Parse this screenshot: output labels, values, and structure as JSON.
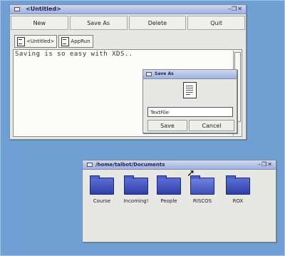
{
  "main_window": {
    "title": "<Untitled>",
    "controls": "–❐✕",
    "toolbar": {
      "new": "New",
      "save_as": "Save As",
      "delete": "Delete",
      "quit": "Quit"
    },
    "tabs": [
      {
        "label": "<Untitled>"
      },
      {
        "label": "AppRun"
      }
    ],
    "text": "Saving is so easy with XDS.."
  },
  "save_dialog": {
    "title": "Save As",
    "filename": "TextFile",
    "save_label": "Save",
    "cancel_label": "Cancel"
  },
  "filer": {
    "title": "/home/talbot/Documents",
    "controls": "–❐✕",
    "items": [
      "Course",
      "Incoming!",
      "People",
      "RISCOS",
      "ROX"
    ]
  }
}
